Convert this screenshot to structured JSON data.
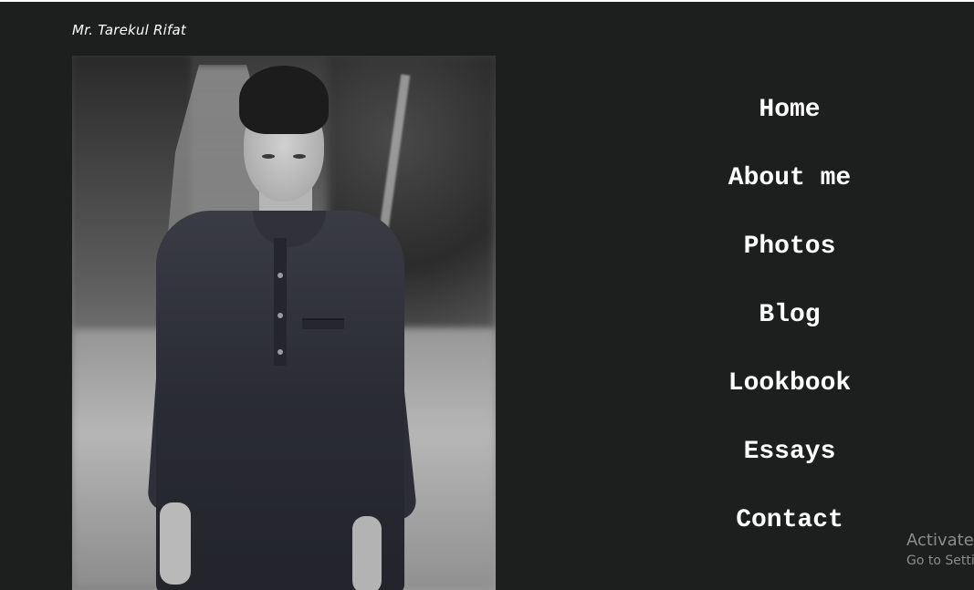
{
  "header": {
    "site_title": "Mr. Tarekul Rifat"
  },
  "photo": {
    "subject": "portrait-photo"
  },
  "nav": {
    "items": [
      {
        "label": "Home"
      },
      {
        "label": "About me"
      },
      {
        "label": "Photos"
      },
      {
        "label": "Blog"
      },
      {
        "label": "Lookbook"
      },
      {
        "label": "Essays"
      },
      {
        "label": "Contact"
      }
    ]
  },
  "watermark": {
    "line1": "Activate Windows",
    "line2": "Go to Settings to activate Windows."
  },
  "colors": {
    "background": "#1d1e1e",
    "text": "#ffffff",
    "watermark": "#8c8c8c"
  }
}
